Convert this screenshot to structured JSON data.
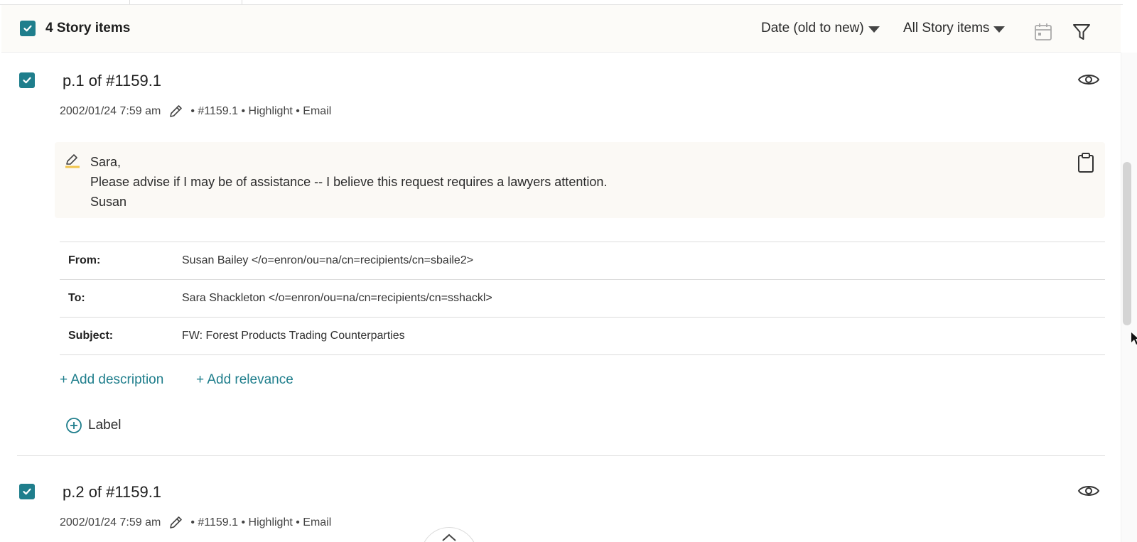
{
  "header": {
    "count_label": "4 Story items",
    "sort_label": "Date (old to new)",
    "filter_label": "All Story items",
    "calendar_icon": "calendar-icon",
    "filter_icon": "funnel-icon"
  },
  "items": [
    {
      "title": "p.1 of #1159.1",
      "date": "2002/01/24 7:59 am",
      "tags": "• #1159.1 • Highlight • Email",
      "highlight_lines": [
        "Sara,",
        "Please advise if I may be of assistance -- I believe this request requires a lawyers attention.",
        "Susan"
      ],
      "fields": [
        {
          "key": "From:",
          "value": "Susan Bailey </o=enron/ou=na/cn=recipients/cn=sbaile2>"
        },
        {
          "key": "To:",
          "value": "Sara Shackleton </o=enron/ou=na/cn=recipients/cn=sshackl>"
        },
        {
          "key": "Subject:",
          "value": "FW: Forest Products Trading Counterparties"
        }
      ],
      "add_description": "+ Add description",
      "add_relevance": "+ Add relevance",
      "label_button": "Label"
    },
    {
      "title": "p.2 of #1159.1",
      "date": "2002/01/24 7:59 am",
      "tags": "• #1159.1 • Highlight • Email"
    }
  ],
  "colors": {
    "accent": "#1f7e8c",
    "highlight_marker": "#f0c44c",
    "header_bg": "#fcfbf8"
  }
}
